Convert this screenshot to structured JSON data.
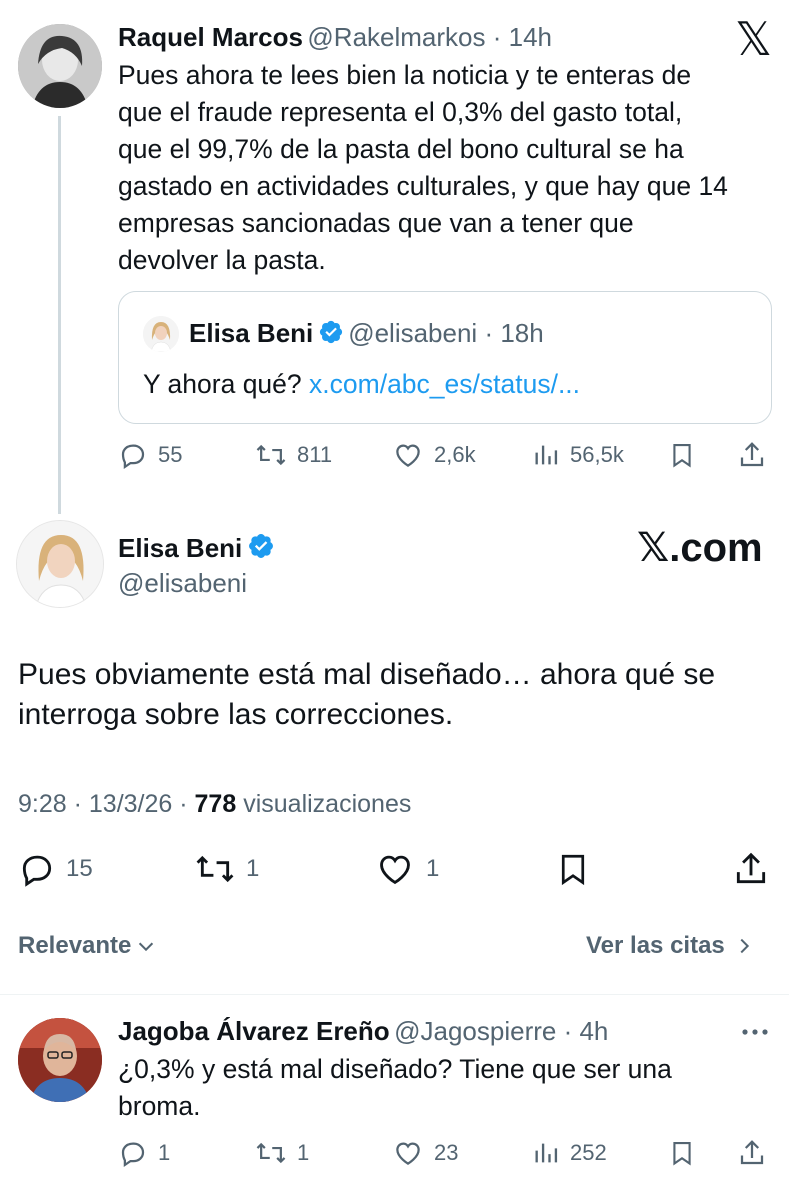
{
  "reply_parent": {
    "author_name": "Raquel Marcos",
    "author_handle": "@Rakelmarkos",
    "time": "14h",
    "text_lines": [
      "Pues ahora te lees bien la noticia y te enteras de",
      "que el fraude representa el 0,3% del gasto total,",
      "que el 99,7% de la pasta del bono cultural se ha",
      "gastado en actividades culturales, y que hay que 14",
      "empresas sancionadas que van a tener que",
      "devolver la pasta."
    ],
    "quote": {
      "author_name": "Elisa Beni",
      "author_handle": "@elisabeni",
      "time": "18h",
      "text": "Y ahora qué?",
      "link": "x.com/abc_es/status/..."
    },
    "stats": {
      "replies": "55",
      "reposts": "811",
      "likes": "2,6k",
      "views": "56,5k"
    }
  },
  "main_tweet": {
    "author_name": "Elisa Beni",
    "author_handle": "@elisabeni",
    "text_lines": [
      "Pues obviamente está mal diseñado… ahora qué se",
      "interroga sobre las correcciones."
    ],
    "time": "9:28",
    "date": "13/3/26",
    "views_count": "778",
    "views_label": "visualizaciones",
    "stats": {
      "replies": "15",
      "reposts": "1",
      "likes": "1"
    }
  },
  "x_logo_text": "𝕏",
  "xcom_label": ".com",
  "filters": {
    "relevance_label": "Relevante",
    "quotes_label": "Ver las citas"
  },
  "reply": {
    "author_name": "Jagoba Álvarez Ereño",
    "author_handle": "@Jagospierre",
    "time": "4h",
    "text_lines": [
      "¿0,3% y está mal diseñado? Tiene que ser una",
      "broma."
    ],
    "stats": {
      "replies": "1",
      "reposts": "1",
      "likes": "23",
      "views": "252"
    }
  },
  "colors": {
    "verified": "#1d9bf0",
    "link": "#1d9bf0",
    "muted": "#536471"
  }
}
